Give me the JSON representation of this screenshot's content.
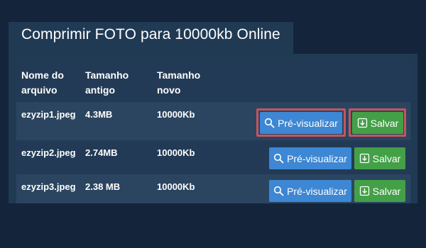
{
  "title": "Comprimir FOTO para 10000kb Online",
  "columns": {
    "name": "Nome do\narquivo",
    "old_size": "Tamanho\nantigo",
    "new_size": "Tamanho\nnovo"
  },
  "rows": [
    {
      "name": "ezyzip1.jpeg",
      "old_size": "4.3MB",
      "new_size": "10000Kb",
      "preview": "Pré-visualizar",
      "save": "Salvar",
      "highlighted": true
    },
    {
      "name": "ezyzip2.jpeg",
      "old_size": "2.74MB",
      "new_size": "10000Kb",
      "preview": "Pré-visualizar",
      "save": "Salvar",
      "highlighted": false
    },
    {
      "name": "ezyzip3.jpeg",
      "old_size": "2.38 MB",
      "new_size": "10000Kb",
      "preview": "Pré-visualizar",
      "save": "Salvar",
      "highlighted": false
    }
  ],
  "icons": {
    "preview": "search-icon",
    "save": "download-icon"
  },
  "colors": {
    "preview_button": "#3d87d4",
    "save_button": "#43a047",
    "highlight": "#c7545c"
  }
}
